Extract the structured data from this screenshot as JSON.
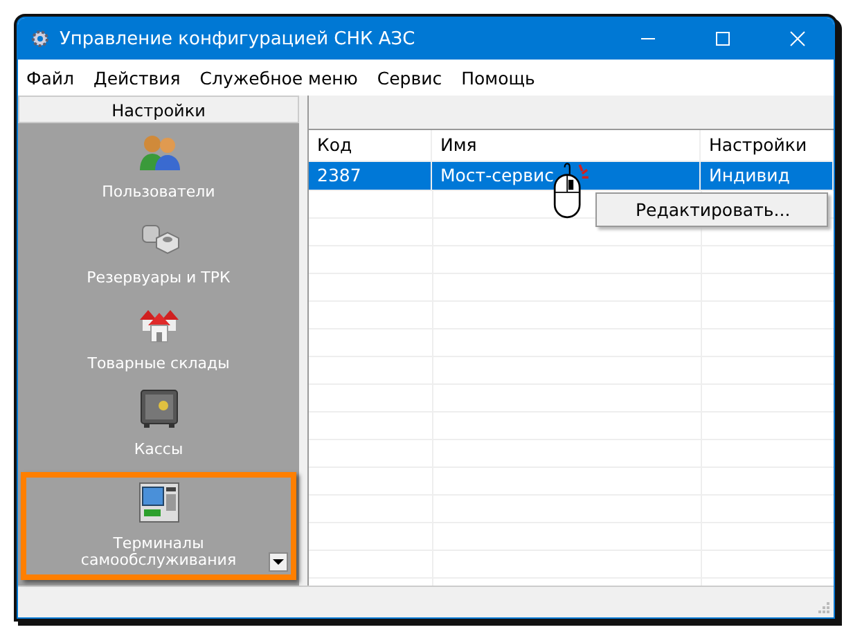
{
  "window": {
    "title": "Управление конфигурацией СНК АЗС"
  },
  "menu_bar": [
    "Файл",
    "Действия",
    "Служебное меню",
    "Сервис",
    "Помощь"
  ],
  "sidebar": {
    "header": "Настройки",
    "items": [
      {
        "kind": "users",
        "label": "Пользователи",
        "highlighted": false
      },
      {
        "kind": "tanks",
        "label": "Резервуары и ТРК",
        "highlighted": false
      },
      {
        "kind": "warehouses",
        "label": "Товарные склады",
        "highlighted": false
      },
      {
        "kind": "cash",
        "label": "Кассы",
        "highlighted": false
      },
      {
        "kind": "terminal",
        "label": "Терминалы самообслуживания",
        "highlighted": true
      }
    ]
  },
  "table": {
    "columns": [
      "Код",
      "Имя",
      "Настройки"
    ],
    "rows": [
      {
        "cells": [
          "2387",
          "Мост-сервис",
          "Индивид"
        ],
        "selected": true
      }
    ]
  },
  "context_menu": {
    "items": [
      "Редактировать..."
    ]
  }
}
